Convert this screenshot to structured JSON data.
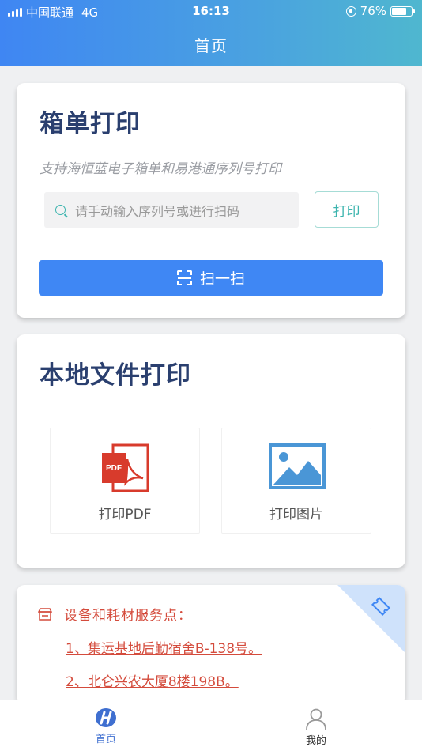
{
  "status_bar": {
    "carrier": "中国联通",
    "network": "4G",
    "time": "16:13",
    "battery_percent": "76%",
    "battery_level": 0.76
  },
  "header": {
    "title": "首页"
  },
  "box_print": {
    "title": "箱单打印",
    "subtitle": "支持海恒蓝电子箱单和易港通序列号打印",
    "search_placeholder": "请手动输入序列号或进行扫码",
    "print_label": "打印",
    "scan_label": "扫一扫"
  },
  "local_print": {
    "title": "本地文件打印",
    "pdf_label": "打印PDF",
    "pdf_badge": "PDF",
    "image_label": "打印图片"
  },
  "service": {
    "title": "设备和耗材服务点：",
    "items": [
      "1、集运基地后勤宿舍B-138号。",
      "2、北仑兴农大厦8楼198B。"
    ]
  },
  "tabbar": {
    "home_label": "首页",
    "me_label": "我的"
  },
  "colors": {
    "primary": "#3f87f4",
    "teal": "#3cb4ae",
    "title_navy": "#2a3f6f",
    "service_red": "#d44b3c",
    "pdf_red": "#d83b2c",
    "image_blue": "#4a96d6"
  },
  "icons": [
    "signal-icon",
    "lock-rotation-icon",
    "battery-icon",
    "search-icon",
    "scan-icon",
    "pdf-file-icon",
    "image-file-icon",
    "shop-icon",
    "ticket-tag-icon",
    "home-logo-icon",
    "person-icon"
  ]
}
